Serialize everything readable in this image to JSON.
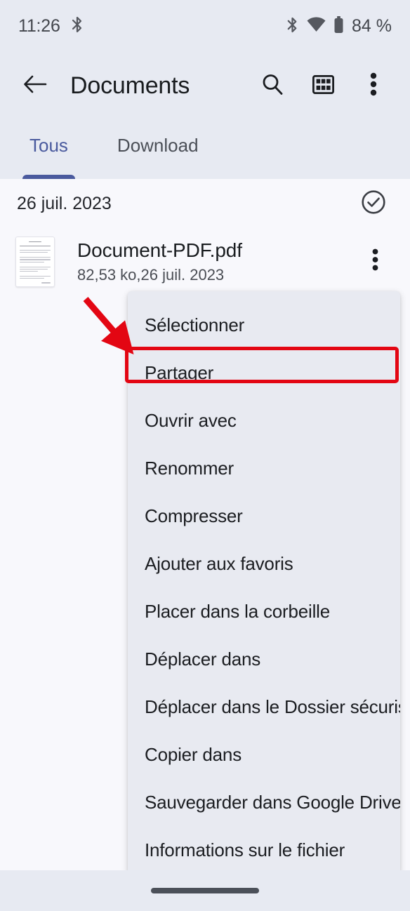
{
  "status_bar": {
    "time": "11:26",
    "bluetooth_icon": "bluetooth-icon",
    "right_icons": [
      "bluetooth-icon",
      "wifi-icon",
      "battery-icon"
    ],
    "battery_text": "84 %"
  },
  "toolbar": {
    "back_icon": "back-arrow-icon",
    "title": "Documents",
    "search_icon": "search-icon",
    "grid_view_icon": "grid-view-icon",
    "overflow_icon": "overflow-menu-icon"
  },
  "tabs": {
    "items": [
      {
        "label": "Tous",
        "active": true
      },
      {
        "label": "Download",
        "active": false
      }
    ],
    "active_color": "#4a5a9e"
  },
  "date_header": {
    "label": "26 juil. 2023",
    "select_all_icon": "check-circle-icon"
  },
  "file": {
    "name": "Document-PDF.pdf",
    "subtitle": "82,53 ko,26 juil. 2023",
    "thumbnail_icon": "document-thumbnail",
    "more_icon": "overflow-menu-icon"
  },
  "context_menu": {
    "items": [
      {
        "label": "Sélectionner",
        "highlighted": false
      },
      {
        "label": "Partager",
        "highlighted": true
      },
      {
        "label": "Ouvrir avec",
        "highlighted": false
      },
      {
        "label": "Renommer",
        "highlighted": false
      },
      {
        "label": "Compresser",
        "highlighted": false
      },
      {
        "label": "Ajouter aux favoris",
        "highlighted": false
      },
      {
        "label": "Placer dans la corbeille",
        "highlighted": false
      },
      {
        "label": "Déplacer dans",
        "highlighted": false
      },
      {
        "label": "Déplacer dans le Dossier sécurisé",
        "highlighted": false
      },
      {
        "label": "Copier dans",
        "highlighted": false
      },
      {
        "label": "Sauvegarder dans Google Drive",
        "highlighted": false
      },
      {
        "label": "Informations sur le fichier",
        "highlighted": false
      }
    ]
  },
  "annotations": {
    "highlight_color": "#e30613",
    "arrow_icon": "red-arrow-pointer",
    "highlight_target": "Partager"
  },
  "nav_bar": {
    "gesture_pill_icon": "gesture-pill"
  }
}
